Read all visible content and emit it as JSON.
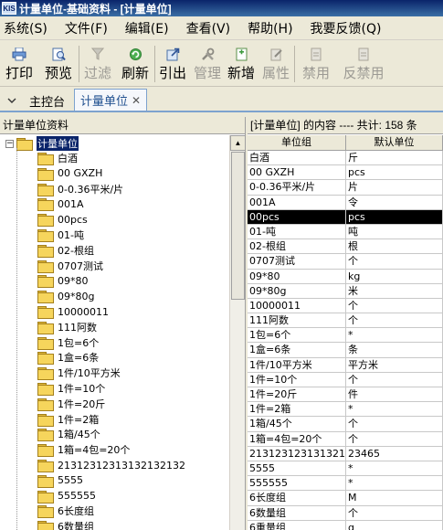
{
  "window": {
    "icon_text": "KIS",
    "title": "计量单位-基础资料 - [计量单位]"
  },
  "menu": [
    {
      "label": "系统(S)"
    },
    {
      "label": "文件(F)"
    },
    {
      "label": "编辑(E)"
    },
    {
      "label": "查看(V)"
    },
    {
      "label": "帮助(H)"
    },
    {
      "label": "我要反馈(Q)"
    }
  ],
  "toolbar": {
    "print": "打印",
    "preview": "预览",
    "filter": "过滤",
    "refresh": "刷新",
    "export": "引出",
    "manage": "管理",
    "add": "新增",
    "properties": "属性",
    "disable": "禁用",
    "undisable": "反禁用"
  },
  "tabs": [
    {
      "label": "主控台"
    },
    {
      "label": "计量单位",
      "close": "✕"
    }
  ],
  "left_panel": {
    "title": "计量单位资料",
    "root": "计量单位",
    "items": [
      "白酒",
      "00 GXZH",
      "0-0.36平米/片",
      "001A",
      "00pcs",
      "01-吨",
      "02-根组",
      "0707测试",
      "09*80",
      "09*80g",
      "10000011",
      "111阿数",
      "1包=6个",
      "1盒=6条",
      "1件/10平方米",
      "1件=10个",
      "1件=20斤",
      "1件=2箱",
      "1箱/45个",
      "1箱=4包=20个",
      "21312312313132132132",
      "5555",
      "555555",
      "6长度组",
      "6数量组",
      "6重量组"
    ]
  },
  "right_panel": {
    "header": "[计量单位] 的内容 ---- 共计: 158 条",
    "columns": [
      "单位组",
      "默认单位"
    ],
    "rows": [
      [
        "白酒",
        "斤"
      ],
      [
        "00 GXZH",
        "pcs"
      ],
      [
        "0-0.36平米/片",
        "片"
      ],
      [
        "001A",
        "令"
      ],
      [
        "00pcs",
        "pcs"
      ],
      [
        "01-吨",
        "吨"
      ],
      [
        "02-根组",
        "根"
      ],
      [
        "0707测试",
        "个"
      ],
      [
        "09*80",
        "kg"
      ],
      [
        "09*80g",
        "米"
      ],
      [
        "10000011",
        "个"
      ],
      [
        "111阿数",
        "个"
      ],
      [
        "1包=6个",
        "*"
      ],
      [
        "1盒=6条",
        "条"
      ],
      [
        "1件/10平方米",
        "平方米"
      ],
      [
        "1件=10个",
        "个"
      ],
      [
        "1件=20斤",
        "件"
      ],
      [
        "1件=2箱",
        "*"
      ],
      [
        "1箱/45个",
        "个"
      ],
      [
        "1箱=4包=20个",
        "个"
      ],
      [
        "21312312313132132",
        "23465"
      ],
      [
        "5555",
        "*"
      ],
      [
        "555555",
        "*"
      ],
      [
        "6长度组",
        "M"
      ],
      [
        "6数量组",
        "个"
      ],
      [
        "6重量组",
        "g"
      ]
    ],
    "selected_row": 4
  }
}
